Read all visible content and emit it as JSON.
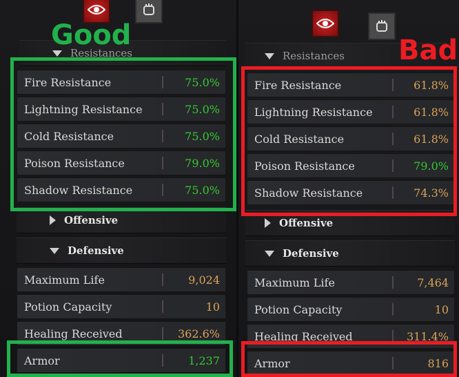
{
  "colors": {
    "highlight_good": "#22b14c",
    "highlight_bad": "#ed1c24",
    "value_green": "#33c933",
    "value_gold": "#d9a35a"
  },
  "left": {
    "badge": "Good",
    "sections": {
      "resistances": "Resistances",
      "offensive": "Offensive",
      "defensive": "Defensive"
    },
    "resistances": [
      {
        "name": "Fire Resistance",
        "value": "75.0%"
      },
      {
        "name": "Lightning Resistance",
        "value": "75.0%"
      },
      {
        "name": "Cold Resistance",
        "value": "75.0%"
      },
      {
        "name": "Poison Resistance",
        "value": "79.0%"
      },
      {
        "name": "Shadow Resistance",
        "value": "75.0%"
      }
    ],
    "defensive": [
      {
        "name": "Maximum Life",
        "value": "9,024"
      },
      {
        "name": "Potion Capacity",
        "value": "10"
      },
      {
        "name": "Healing Received",
        "value": "362.6%"
      },
      {
        "name": "Armor",
        "value": "1,237"
      }
    ]
  },
  "right": {
    "badge": "Bad",
    "sections": {
      "resistances": "Resistances",
      "offensive": "Offensive",
      "defensive": "Defensive"
    },
    "resistances": [
      {
        "name": "Fire Resistance",
        "value": "61.8%"
      },
      {
        "name": "Lightning Resistance",
        "value": "61.8%"
      },
      {
        "name": "Cold Resistance",
        "value": "61.8%"
      },
      {
        "name": "Poison Resistance",
        "value": "79.0%"
      },
      {
        "name": "Shadow Resistance",
        "value": "74.3%"
      }
    ],
    "defensive": [
      {
        "name": "Maximum Life",
        "value": "7,464"
      },
      {
        "name": "Potion Capacity",
        "value": "10"
      },
      {
        "name": "Healing Received",
        "value": "311.4%"
      },
      {
        "name": "Armor",
        "value": "816"
      }
    ]
  }
}
